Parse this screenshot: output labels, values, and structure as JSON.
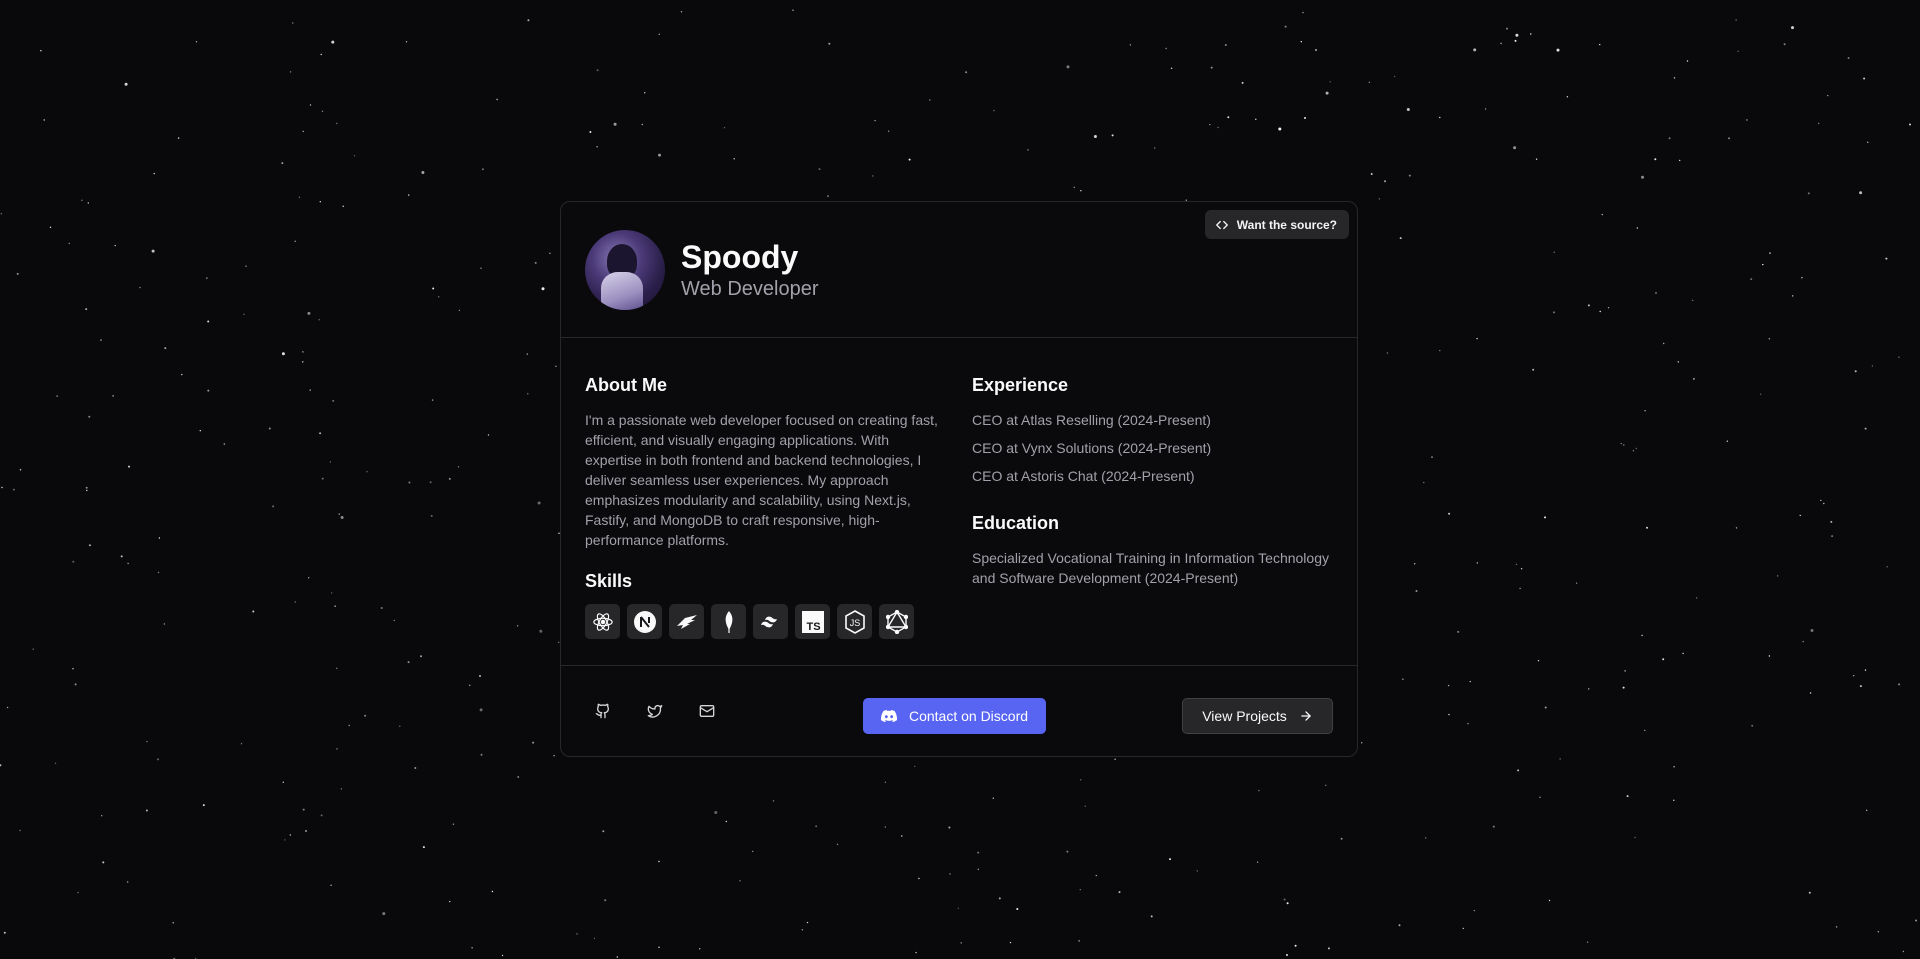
{
  "source_button": {
    "label": "Want the source?",
    "icon": "code-icon"
  },
  "profile": {
    "name": "Spoody",
    "role": "Web Developer"
  },
  "about": {
    "heading": "About Me",
    "text": "I'm a passionate web developer focused on creating fast, efficient, and visually engaging applications. With expertise in both frontend and backend technologies, I deliver seamless user experiences. My approach emphasizes modularity and scalability, using Next.js, Fastify, and MongoDB to craft responsive, high-performance platforms."
  },
  "skills": {
    "heading": "Skills",
    "items": [
      "react-icon",
      "nextjs-icon",
      "fastify-icon",
      "mongodb-icon",
      "tailwind-icon",
      "typescript-icon",
      "nodejs-icon",
      "graphql-icon"
    ]
  },
  "experience": {
    "heading": "Experience",
    "items": [
      "CEO at Atlas Reselling (2024-Present)",
      "CEO at Vynx Solutions (2024-Present)",
      "CEO at Astoris Chat (2024-Present)"
    ]
  },
  "education": {
    "heading": "Education",
    "text": "Specialized Vocational Training in Information Technology and Software Development (2024-Present)"
  },
  "footer": {
    "social": [
      "github-icon",
      "twitter-icon",
      "mail-icon"
    ],
    "discord_label": "Contact on Discord",
    "projects_label": "View Projects"
  },
  "colors": {
    "background": "#09090b",
    "card_border": "#27272a",
    "discord": "#5865f2",
    "muted_text": "#a1a1aa"
  }
}
